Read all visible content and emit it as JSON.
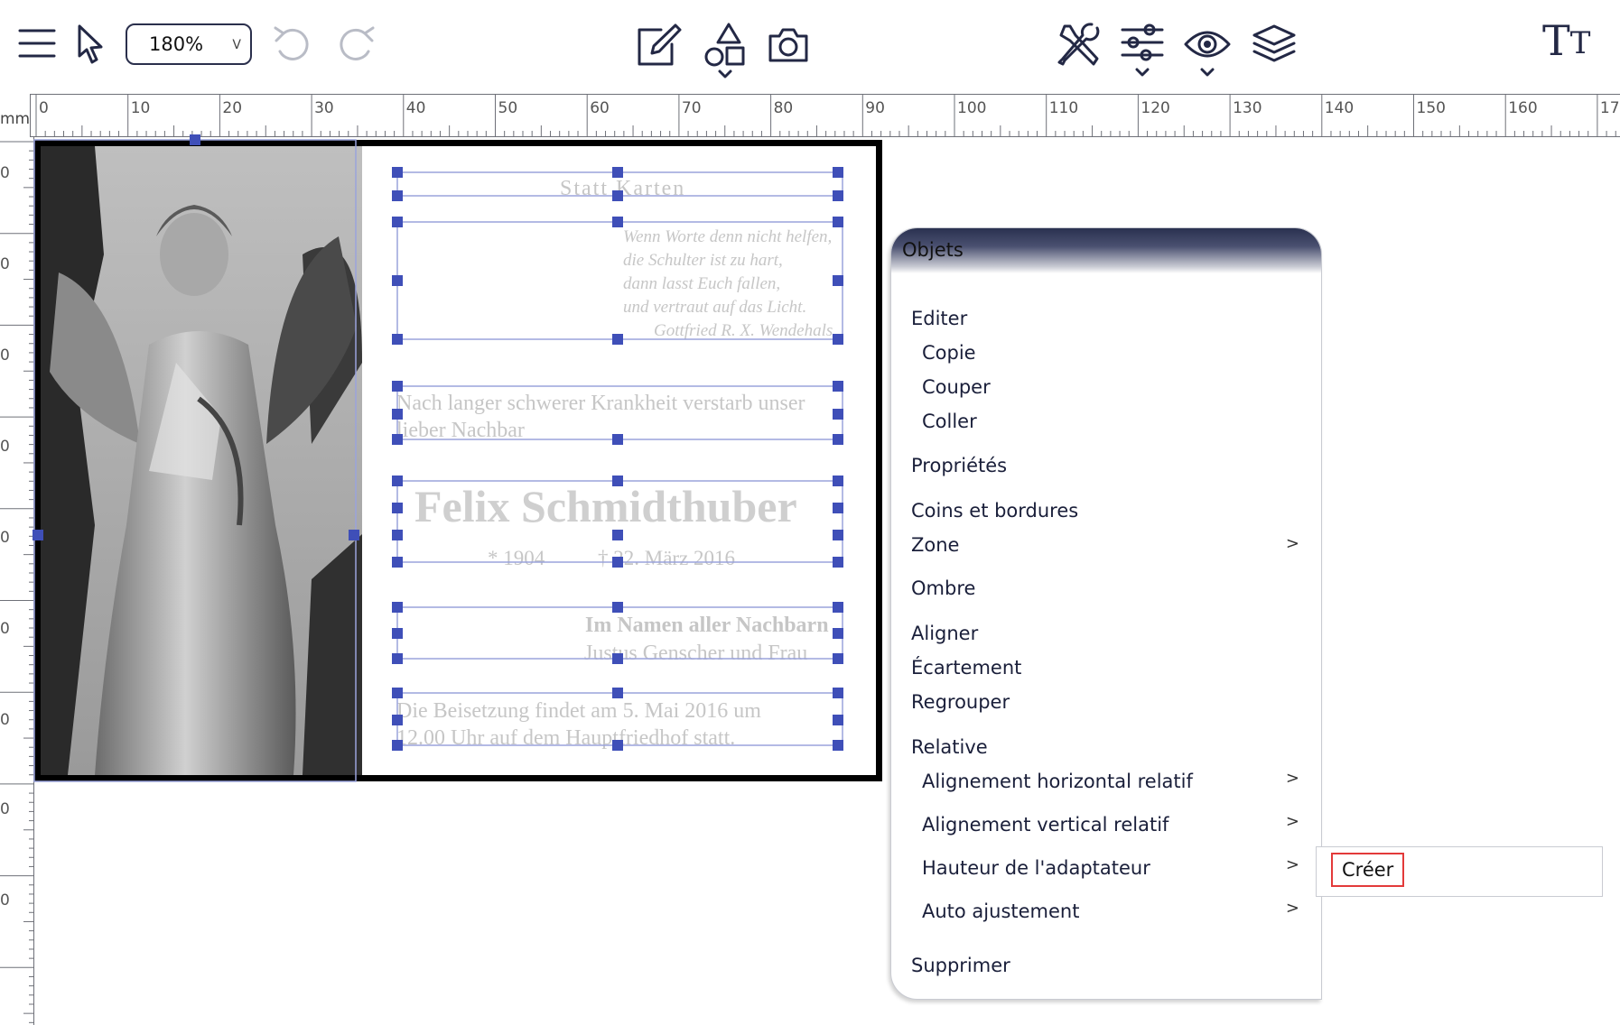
{
  "toolbar": {
    "zoom_value": "180%",
    "icons": [
      "menu-icon",
      "pointer-icon",
      "undo-icon",
      "redo-icon",
      "edit-icon",
      "shapes-icon",
      "camera-icon",
      "tools-icon",
      "sliders-icon",
      "eye-icon",
      "layers-icon",
      "text-size-icon"
    ],
    "text_tool_big": "T",
    "text_tool_small": "T"
  },
  "ruler": {
    "unit": "mm",
    "ticks": [
      "0",
      "10",
      "20",
      "30",
      "40",
      "50",
      "60",
      "70",
      "80",
      "90",
      "100",
      "110",
      "120",
      "130",
      "140",
      "150",
      "160",
      "17"
    ],
    "vertical_labels": [
      "0",
      "0",
      "0",
      "0",
      "0",
      "0",
      "0",
      "0",
      "0",
      "0"
    ]
  },
  "card": {
    "heading": "Statt Karten",
    "poem": [
      "Wenn Worte denn nicht helfen,",
      "die Schulter ist zu hart,",
      "dann lasst Euch fallen,",
      "und vertraut auf das Licht."
    ],
    "poem_author": "Gottfried R. X. Wendehals",
    "intro_line1": "Nach langer schwerer Krankheit verstarb unser",
    "intro_line2": "lieber Nachbar",
    "name": "Felix Schmidthuber",
    "birth": "* 1904",
    "death": "† 22. März 2016",
    "sign_line1": "Im Namen aller Nachbarn",
    "sign_line2": "Justus Genscher und Frau",
    "funeral_line1": "Die Beisetzung findet am 5. Mai 2016 um",
    "funeral_line2": "12.00 Uhr auf dem Hauptfriedhof statt."
  },
  "context_menu": {
    "title": "Objets",
    "editer": "Editer",
    "copie": "Copie",
    "couper": "Couper",
    "coller": "Coller",
    "proprietes": "Propriétés",
    "coins": "Coins et bordures",
    "zone": "Zone",
    "ombre": "Ombre",
    "aligner": "Aligner",
    "ecartement": "Écartement",
    "regrouper": "Regrouper",
    "relative": "Relative",
    "align_h": "Alignement horizontal relatif",
    "align_v": "Alignement vertical relatif",
    "hauteur": "Hauteur de l'adaptateur",
    "auto": "Auto ajustement",
    "supprimer": "Supprimer",
    "arrow": ">"
  },
  "submenu": {
    "creer": "Créer"
  }
}
